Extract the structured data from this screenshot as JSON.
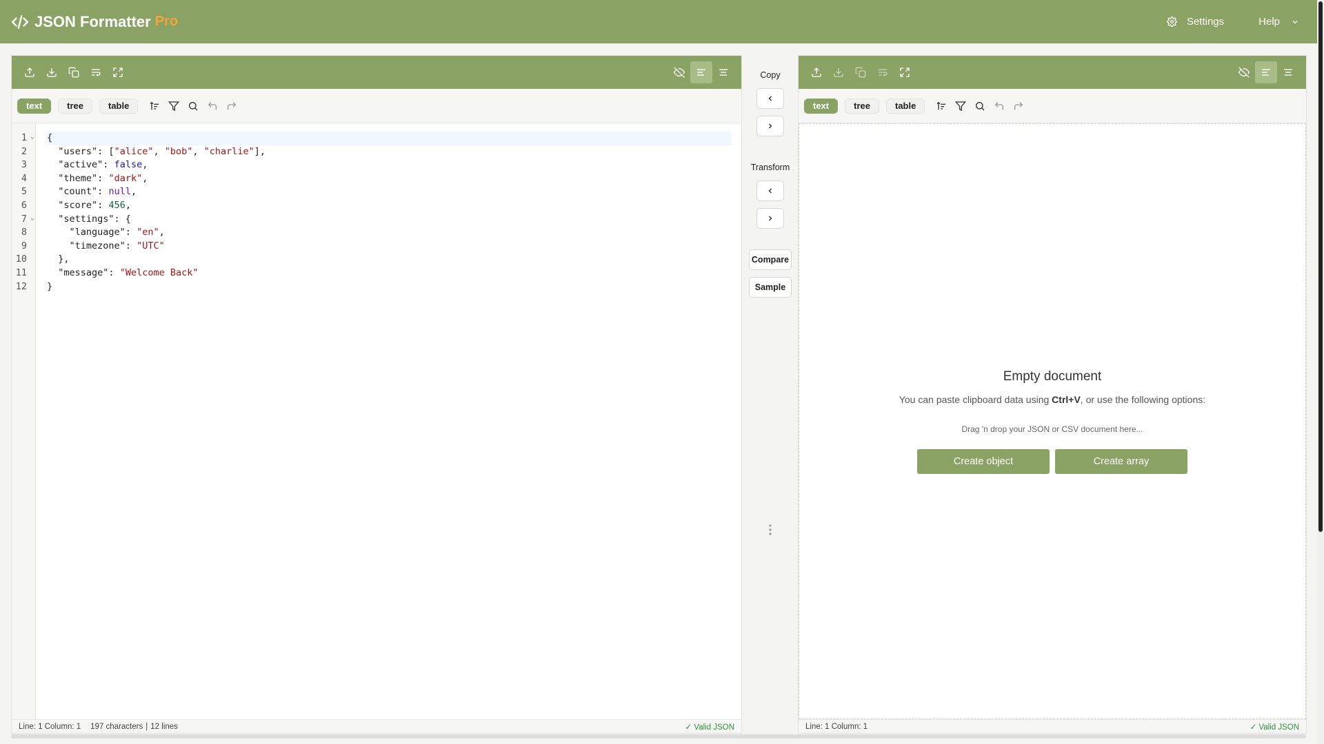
{
  "app": {
    "title": "JSON Formatter",
    "badge": "Pro"
  },
  "topnav": {
    "settings": "Settings",
    "help": "Help"
  },
  "left": {
    "modes": [
      "text",
      "tree",
      "table"
    ],
    "active_mode": "text",
    "line_numbers": [
      "1",
      "2",
      "3",
      "4",
      "5",
      "6",
      "7",
      "8",
      "9",
      "10",
      "11",
      "12"
    ],
    "status": {
      "position": "Line: 1 Column: 1",
      "chars": "197 characters",
      "lines": "12 lines",
      "valid": "✓ Valid JSON"
    }
  },
  "middle": {
    "copy_label": "Copy",
    "transform_label": "Transform",
    "compare": "Compare",
    "sample": "Sample"
  },
  "right": {
    "modes": [
      "text",
      "tree",
      "table"
    ],
    "empty_title": "Empty document",
    "empty_sub_pre": "You can paste clipboard data using ",
    "empty_sub_key": "Ctrl+V",
    "empty_sub_post": ", or use the following options:",
    "drag_note": "Drag 'n drop your JSON or CSV document here...",
    "create_object": "Create object",
    "create_array": "Create array",
    "status": {
      "position": "Line: 1 Column: 1",
      "valid": "✓ Valid JSON"
    }
  },
  "code": {
    "l1": "{",
    "users_key": "\"users\"",
    "users_v1": "\"alice\"",
    "users_v2": "\"bob\"",
    "users_v3": "\"charlie\"",
    "active_key": "\"active\"",
    "active_val": "false",
    "theme_key": "\"theme\"",
    "theme_val": "\"dark\"",
    "count_key": "\"count\"",
    "count_val": "null",
    "score_key": "\"score\"",
    "score_val": "456",
    "settings_key": "\"settings\"",
    "language_key": "\"language\"",
    "language_val": "\"en\"",
    "timezone_key": "\"timezone\"",
    "timezone_val": "\"UTC\"",
    "message_key": "\"message\"",
    "message_val": "\"Welcome Back\"",
    "l12": "}"
  }
}
